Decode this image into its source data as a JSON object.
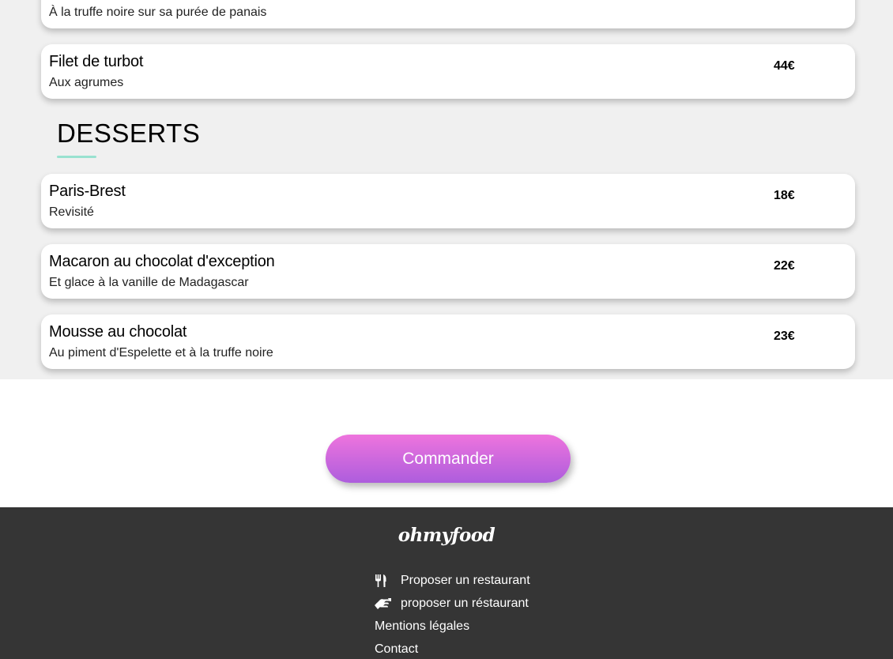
{
  "menu": {
    "partial_top_dish": {
      "description": "À la truffe noire sur sa purée de panais"
    },
    "main_dishes": [
      {
        "name": "Filet de turbot",
        "description": "Aux agrumes",
        "price": "44€"
      }
    ],
    "desserts_section": {
      "title": "DESSERTS",
      "items": [
        {
          "name": "Paris-Brest",
          "description": "Revisité",
          "price": "18€"
        },
        {
          "name": "Macaron au chocolat d'exception",
          "description": "Et glace à la vanille de Madagascar",
          "price": "22€"
        },
        {
          "name": "Mousse au chocolat",
          "description": "Au piment d'Espelette et à la truffe noire",
          "price": "23€"
        }
      ]
    },
    "accent_color": "#99e2d0"
  },
  "order": {
    "button_label": "Commander",
    "gradient_start": "#ee74dd",
    "gradient_end": "#ad5ddd"
  },
  "footer": {
    "logo": "ohmyfood",
    "links": [
      {
        "label": "Proposer un restaurant",
        "icon": "utensils-icon"
      },
      {
        "label": "proposer un réstaurant",
        "icon": "handshake-icon"
      },
      {
        "label": "Mentions légales",
        "icon": ""
      },
      {
        "label": "Contact",
        "icon": ""
      }
    ],
    "background_color": "#353535"
  }
}
